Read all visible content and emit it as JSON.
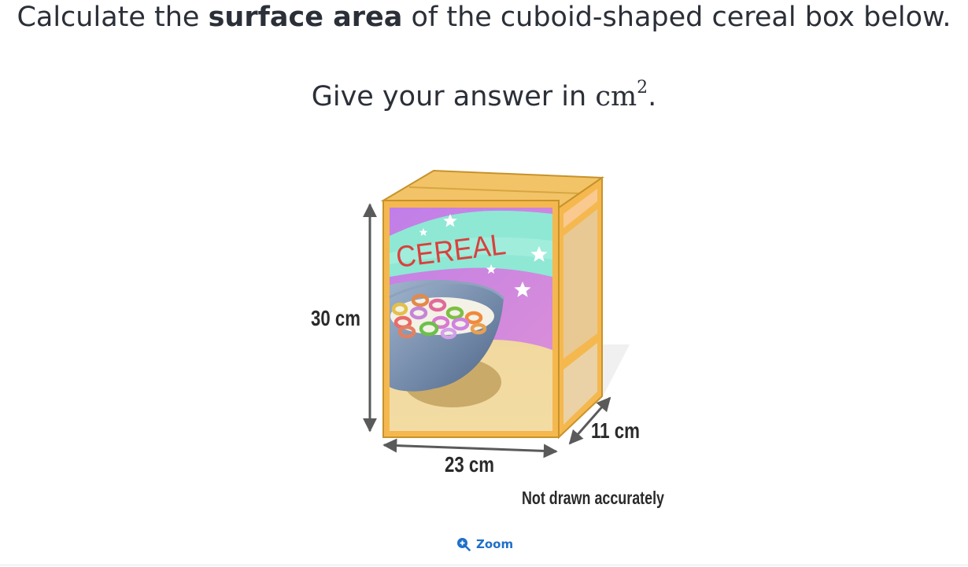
{
  "question": {
    "part1": "Calculate the ",
    "bold": "surface area",
    "part2": " of the cuboid-shaped cereal box below.",
    "line2_text": "Give your answer in ",
    "unit_base": "cm",
    "unit_exp": "2",
    "line2_end": "."
  },
  "figure": {
    "box_title": "CEREAL",
    "height_label": "30 cm",
    "width_label": "23 cm",
    "depth_label": "11 cm",
    "note": "Not drawn accurately"
  },
  "zoom": {
    "label": "Zoom",
    "icon": "zoom-in-icon",
    "color": "#1f6fc9"
  }
}
